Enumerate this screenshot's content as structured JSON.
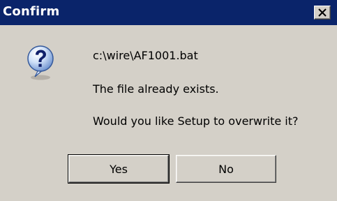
{
  "dialog": {
    "title": "Confirm",
    "icon": "question-icon",
    "messages": [
      "c:\\wire\\AF1001.bat",
      "The file already exists.",
      "Would you like Setup to overwrite it?"
    ],
    "buttons": {
      "yes_label": "Yes",
      "no_label": "No"
    }
  },
  "colors": {
    "titlebar": "#0a246a",
    "face": "#d4d0c8",
    "title_text": "#ffffff"
  }
}
